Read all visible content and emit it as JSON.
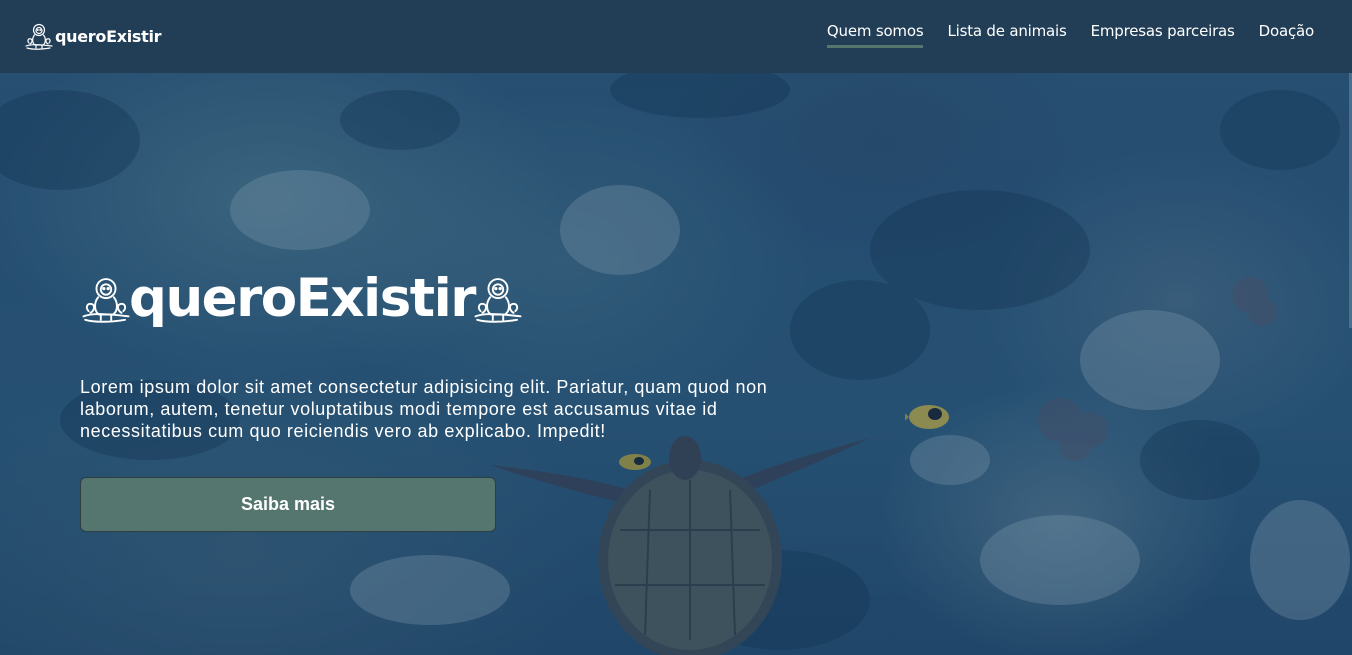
{
  "header": {
    "brand_name": "queroExistir",
    "brand_icon": "monkey-icon",
    "nav": [
      {
        "label": "Quem somos",
        "active": true
      },
      {
        "label": "Lista de animais",
        "active": false
      },
      {
        "label": "Empresas parceiras",
        "active": false
      },
      {
        "label": "Doação",
        "active": false
      }
    ]
  },
  "hero": {
    "title": "queroExistir",
    "text": "Lorem ipsum dolor sit amet consectetur adipisicing elit. Pariatur, quam quod non laborum, autem, tenetur voluptatibus modi tempore est accusamus vitae id necessitatibus cum quo reiciendis vero ab explicabo. Impedit!",
    "button_label": "Saiba mais",
    "background": "sea-turtle-underwater-image"
  },
  "colors": {
    "header_bg": "#213e56",
    "accent": "#54766f",
    "text": "#ffffff"
  }
}
